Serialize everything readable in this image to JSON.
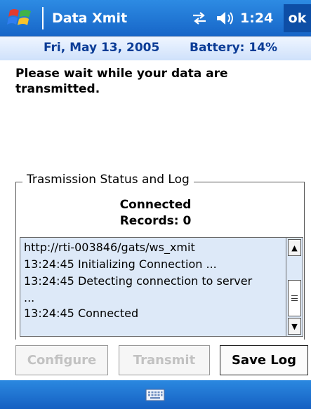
{
  "title_bar": {
    "app_title": "Data Xmit",
    "time": "1:24",
    "ok_label": "ok",
    "icons": [
      "windows-start-icon",
      "connectivity-icon",
      "speaker-icon"
    ]
  },
  "date_bar": {
    "date": "Fri, May 13, 2005",
    "battery": "Battery: 14%"
  },
  "message": "Please wait while your data are transmitted.",
  "group": {
    "legend": "Trasmission Status and Log",
    "status": "Connected",
    "records": "Records: 0"
  },
  "log": {
    "lines": [
      "http://rti-003846/gats/ws_xmit",
      "13:24:45 Initializing Connection ...",
      "13:24:45 Detecting connection to server",
      "...",
      "13:24:45 Connected"
    ]
  },
  "buttons": {
    "configure": "Configure",
    "transmit": "Transmit",
    "save_log": "Save Log"
  },
  "bottom_bar": {
    "icons": [
      "keyboard-icon"
    ]
  },
  "colors": {
    "title_bar": "#1f78d6",
    "date_text": "#0b3c96",
    "log_background": "#dde9f8",
    "disabled_text": "#c2c2c2"
  }
}
